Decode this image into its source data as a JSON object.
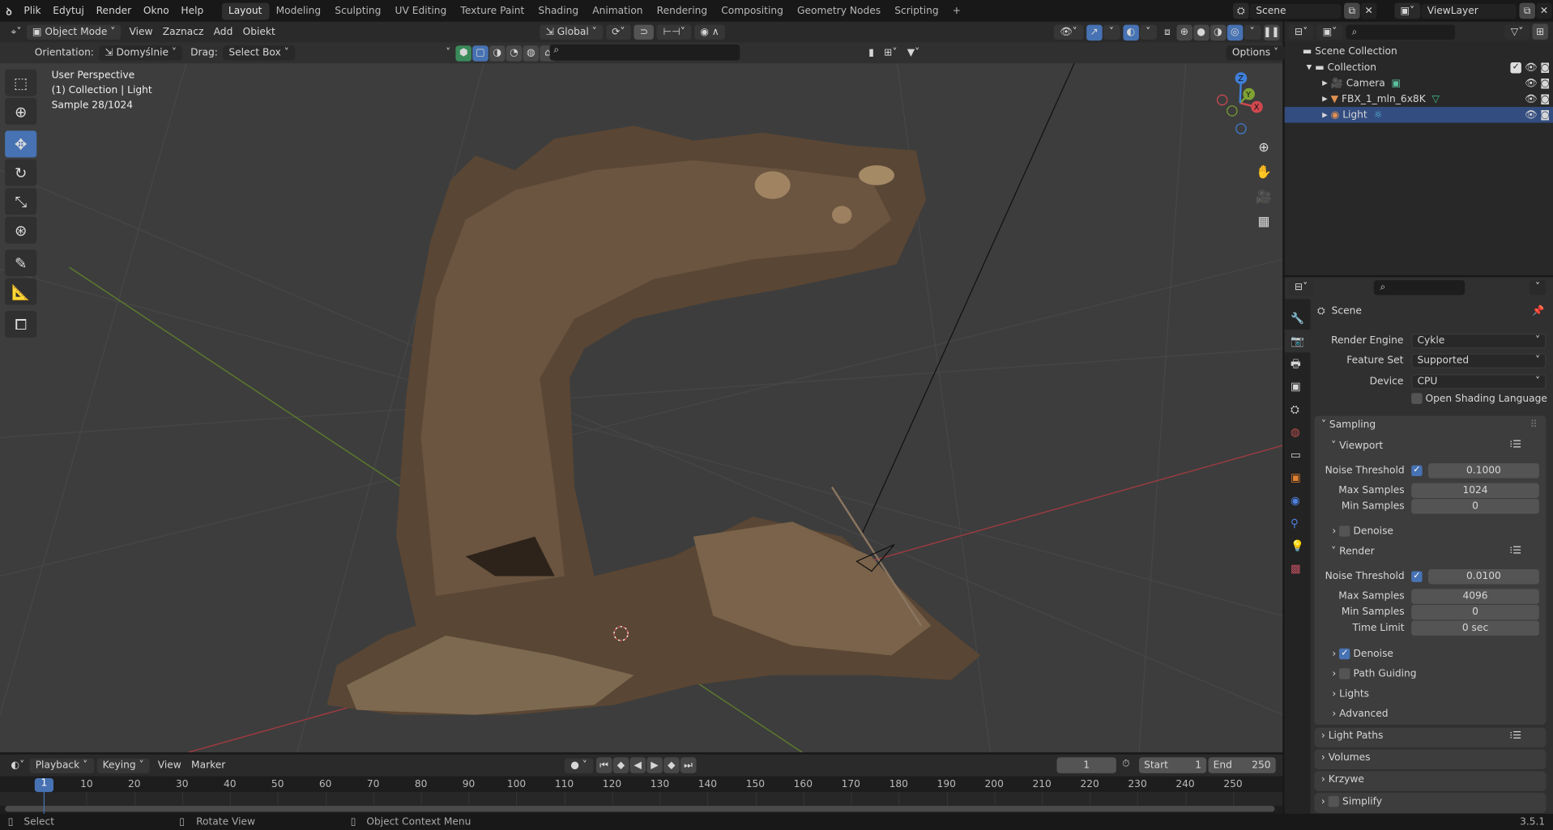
{
  "menubar": {
    "items": [
      "Plik",
      "Edytuj",
      "Render",
      "Okno",
      "Help"
    ],
    "workspaces": [
      "Layout",
      "Modeling",
      "Sculpting",
      "UV Editing",
      "Texture Paint",
      "Shading",
      "Animation",
      "Rendering",
      "Compositing",
      "Geometry Nodes",
      "Scripting"
    ],
    "active_workspace": "Layout",
    "add": "+",
    "scene": "Scene",
    "view_layer": "ViewLayer"
  },
  "viewport_header": {
    "mode": "Object Mode",
    "menus": [
      "View",
      "Zaznacz",
      "Add",
      "Obiekt"
    ],
    "transform_orientation": "Global",
    "options": "Options"
  },
  "tool_settings": {
    "orientation_label": "Orientation:",
    "orientation_value": "Domyślnie",
    "drag_label": "Drag:",
    "drag_value": "Select Box"
  },
  "viewport_overlay": {
    "line1": "User Perspective",
    "line2": "(1) Collection | Light",
    "line3": "Sample 28/1024"
  },
  "gizmo": {
    "x": "X",
    "y": "Y",
    "z": "Z"
  },
  "outliner": {
    "root": "Scene Collection",
    "collection": "Collection",
    "items": [
      "Camera",
      "FBX_1_mln_6x8K",
      "Light"
    ],
    "selected": "Light"
  },
  "properties": {
    "context": "Scene",
    "render_engine_label": "Render Engine",
    "render_engine": "Cykle",
    "feature_set_label": "Feature Set",
    "feature_set": "Supported",
    "device_label": "Device",
    "device": "CPU",
    "osl_label": "Open Shading Language",
    "sampling": "Sampling",
    "viewport": {
      "title": "Viewport",
      "noise_label": "Noise Threshold",
      "noise": "0.1000",
      "max_label": "Max Samples",
      "max": "1024",
      "min_label": "Min Samples",
      "min": "0",
      "denoise": "Denoise"
    },
    "render": {
      "title": "Render",
      "noise_label": "Noise Threshold",
      "noise": "0.0100",
      "max_label": "Max Samples",
      "max": "4096",
      "min_label": "Min Samples",
      "min": "0",
      "time_label": "Time Limit",
      "time": "0 sec",
      "denoise": "Denoise"
    },
    "path_guiding": "Path Guiding",
    "lights": "Lights",
    "advanced": "Advanced",
    "panels": [
      "Light Paths",
      "Volumes",
      "Krzywe",
      "Simplify"
    ]
  },
  "timeline": {
    "menus": [
      "Playback",
      "Keying",
      "View",
      "Marker"
    ],
    "current_frame": "1",
    "start_label": "Start",
    "start": "1",
    "end_label": "End",
    "end": "250",
    "ticks": [
      "10",
      "20",
      "30",
      "40",
      "50",
      "60",
      "70",
      "80",
      "90",
      "100",
      "110",
      "120",
      "130",
      "140",
      "150",
      "160",
      "170",
      "180",
      "190",
      "200",
      "210",
      "220",
      "230",
      "240",
      "250"
    ],
    "playhead": "1"
  },
  "statusbar": {
    "select": "Select",
    "rotate": "Rotate View",
    "context_menu": "Object Context Menu",
    "version": "3.5.1"
  },
  "colors": {
    "accent": "#4772b3",
    "x_axis": "#d0484f",
    "y_axis": "#7ea233",
    "z_axis": "#3f7fd8"
  }
}
